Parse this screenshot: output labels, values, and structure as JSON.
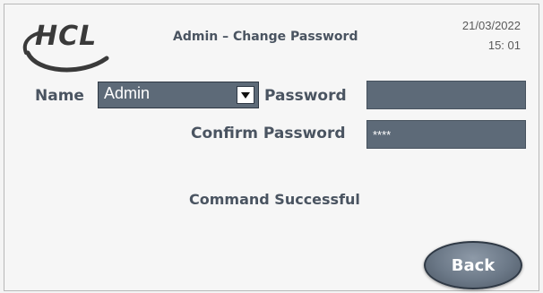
{
  "header": {
    "logo_text": "HCL",
    "title": "Admin – Change Password",
    "date": "21/03/2022",
    "time": "15: 01"
  },
  "form": {
    "name_label": "Name",
    "name_value": "Admin",
    "password_label": "Password",
    "password_value": "",
    "confirm_label": "Confirm Password",
    "confirm_value": "****"
  },
  "status": {
    "message": "Command Successful"
  },
  "actions": {
    "back_label": "Back"
  },
  "colors": {
    "field_bg": "#5d6a78",
    "label_text": "#4a5461",
    "button_bg": "#6b7887"
  },
  "icons": {
    "logo": "hcl-logo",
    "dropdown": "chevron-down-icon"
  }
}
